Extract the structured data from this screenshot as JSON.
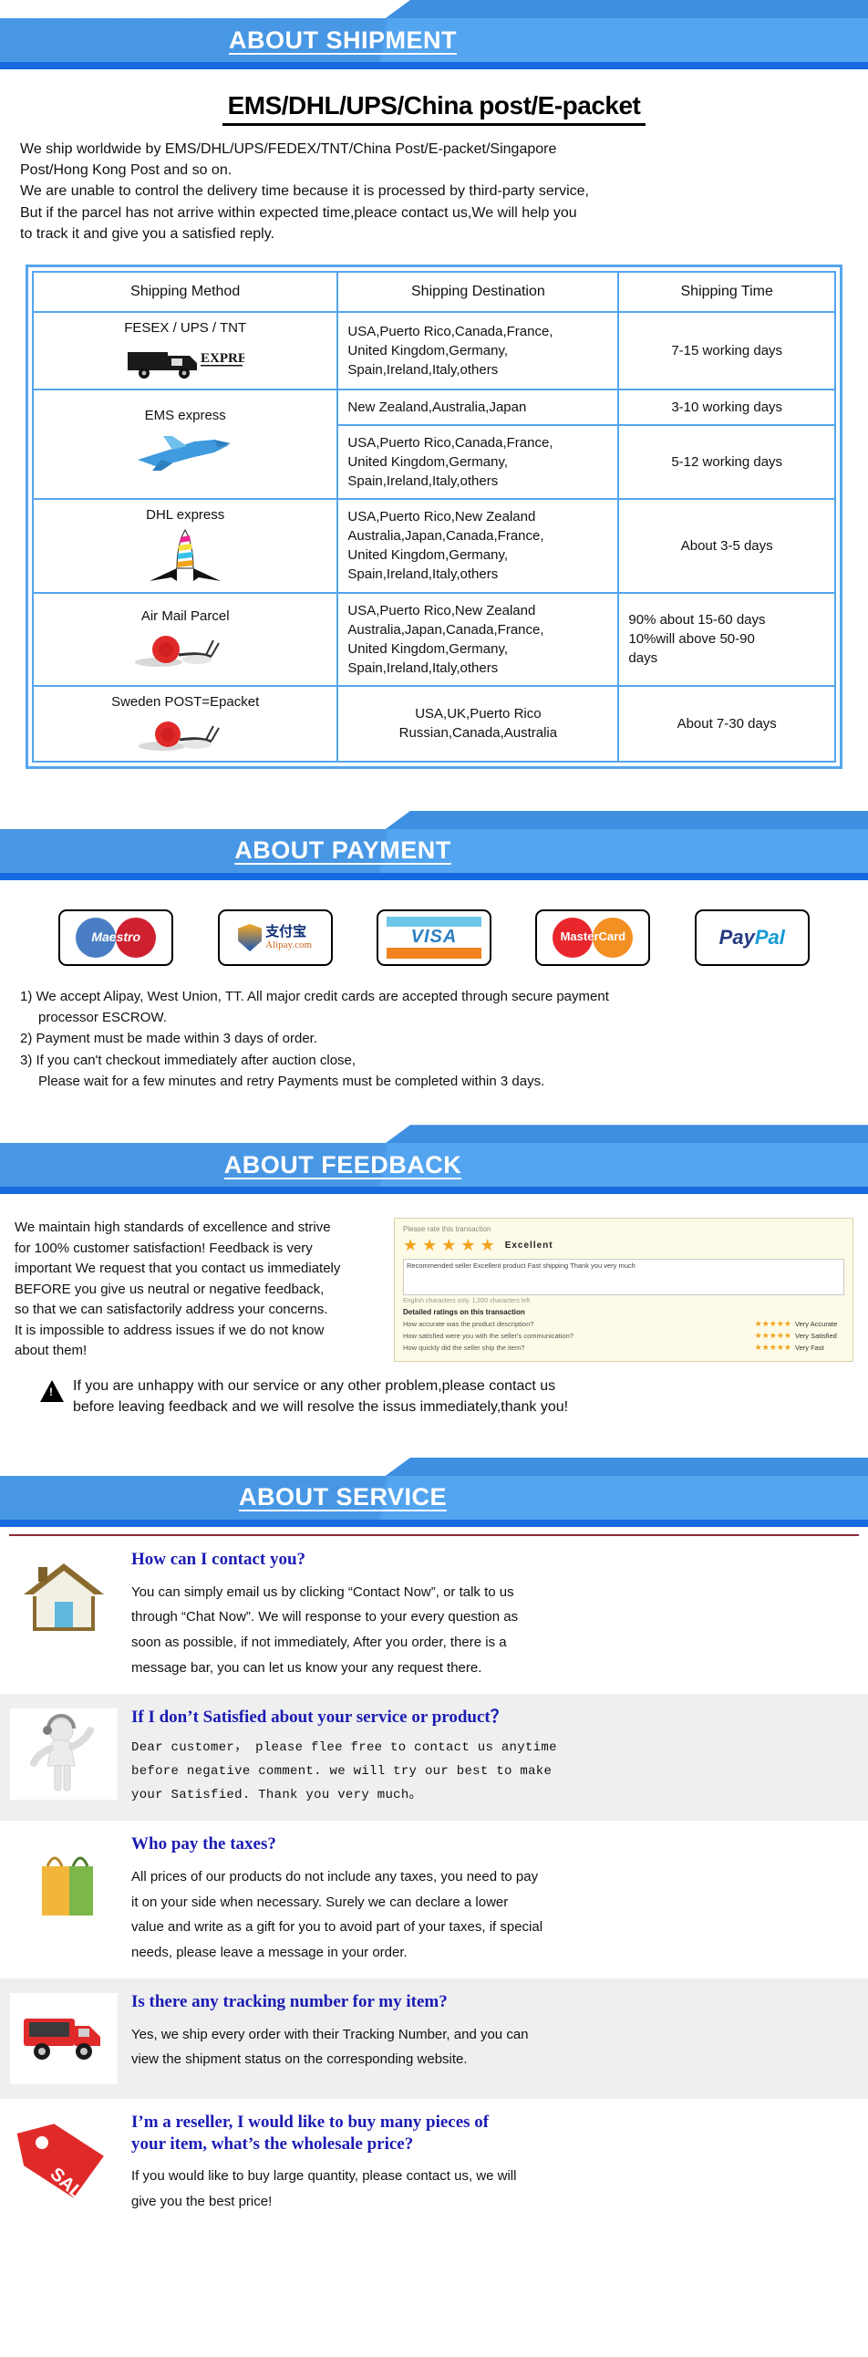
{
  "sections": {
    "shipment": {
      "banner": "ABOUT SHIPMENT",
      "title": "EMS/DHL/UPS/China post/E-packet",
      "intro": [
        "We ship worldwide by EMS/DHL/UPS/FEDEX/TNT/China Post/E-packet/Singapore",
        "Post/Hong Kong Post and so on.",
        "We are unable to control the delivery time because it is processed by third-party service,",
        "But if the parcel has not arrive within expected time,pleace contact us,We will help you",
        "to track it and give you a satisfied reply."
      ],
      "table": {
        "headers": [
          "Shipping Method",
          "Shipping Destination",
          "Shipping Time"
        ],
        "rows": [
          {
            "method": "FESEX / UPS / TNT",
            "icon": "truck-express-icon",
            "destination": "USA,Puerto Rico,Canada,France,\nUnited Kingdom,Germany,\nSpain,Ireland,Italy,others",
            "time": "7-15 working days"
          },
          {
            "method": "EMS express",
            "icon": "airplane-icon",
            "destination": "New Zealand,Australia,Japan",
            "time": "3-10 working days"
          },
          {
            "method": "",
            "icon": "",
            "destination": "USA,Puerto Rico,Canada,France,\nUnited Kingdom,Germany,\nSpain,Ireland,Italy,others",
            "time": "5-12 working days"
          },
          {
            "method": "DHL express",
            "icon": "dhl-rocket-icon",
            "destination": "USA,Puerto Rico,New Zealand\nAustralia,Japan,Canada,France,\nUnited Kingdom,Germany,\nSpain,Ireland,Italy,others",
            "time": "About 3-5 days"
          },
          {
            "method": "Air Mail Parcel",
            "icon": "snail-icon",
            "destination": "USA,Puerto Rico,New Zealand\nAustralia,Japan,Canada,France,\nUnited Kingdom,Germany,\nSpain,Ireland,Italy,others",
            "time": "90% about 15-60 days\n10%will above 50-90\ndays"
          },
          {
            "method": "Sweden POST=Epacket",
            "icon": "snail-icon",
            "destination": "USA,UK,Puerto Rico\nRussian,Canada,Australia",
            "time": "About 7-30 days"
          }
        ]
      }
    },
    "payment": {
      "banner": "ABOUT PAYMENT",
      "logos": [
        {
          "name": "maestro-logo",
          "label": "Maestro"
        },
        {
          "name": "alipay-logo",
          "label": "支付宝",
          "sub": "Alipay.com"
        },
        {
          "name": "visa-logo",
          "label": "VISA"
        },
        {
          "name": "mastercard-logo",
          "label": "MasterCard"
        },
        {
          "name": "paypal-logo",
          "label_a": "Pay",
          "label_b": "Pal"
        }
      ],
      "terms": [
        "1) We accept Alipay, West Union, TT. All major credit cards are accepted through secure payment",
        "processor ESCROW.",
        "2) Payment must be made within 3 days of order.",
        "3) If you can't checkout immediately after auction close,",
        "Please wait for a few minutes and retry Payments must be completed within 3 days."
      ]
    },
    "feedback": {
      "banner": "ABOUT FEEDBACK",
      "text": [
        "We maintain high standards of excellence and strive",
        "for 100% customer satisfaction! Feedback is very",
        "important We request that you contact us immediately",
        "BEFORE you give us neutral or negative feedback,",
        "so that we can satisfactorily address your concerns.",
        "It is impossible to address issues if we do not know",
        "about them!"
      ],
      "widget": {
        "prompt": "Please rate this transaction",
        "rating_label": "Excellent",
        "comment": "Recommended seller Excellent product Fast shipping Thank you very much",
        "char_note": "English characters only, 1,000 characters left",
        "detail_header": "Detailed ratings on this transaction",
        "detail_rows": [
          {
            "question": "How accurate was the product description?",
            "value": "Very Accurate"
          },
          {
            "question": "How satisfied were you with the seller's communication?",
            "value": "Very Satisfied"
          },
          {
            "question": "How quickly did the seller ship the item?",
            "value": "Very Fast"
          }
        ]
      },
      "warning": [
        "If you are unhappy with our service or any other problem,please contact us",
        "before leaving feedback and we will resolve the issus immediately,thank you!"
      ]
    },
    "service": {
      "banner": "ABOUT SERVICE",
      "items": [
        {
          "icon": "house-icon",
          "question": "How can I contact you?",
          "answer_lines": [
            "You can simply email us by clicking “Contact Now”, or talk to us",
            "through “Chat Now”. We will response to your every question as",
            "soon as possible, if not immediately, After you order, there is a",
            "message bar, you can let us know your any request there."
          ],
          "style": "normal"
        },
        {
          "icon": "support-person-icon",
          "question": "If I don’t Satisfied about your service or product？",
          "answer_lines": [
            "Dear customer， please flee free to contact us anytime",
            "before negative comment. we will try our best to make",
            "your Satisfied.  Thank you very much。"
          ],
          "style": "mono"
        },
        {
          "icon": "shopping-bag-icon",
          "question": "Who pay the taxes?",
          "answer_lines": [
            " All prices of our products do not include any taxes, you need to pay",
            "it on your side when necessary. Surely we can declare a lower",
            "value and write as a gift for you to avoid part of your taxes, if special",
            "needs, please leave a message in your order."
          ],
          "style": "normal"
        },
        {
          "icon": "delivery-truck-icon",
          "question": "Is there any tracking number for my item?",
          "answer_lines": [
            " Yes, we ship every order with their Tracking Number, and you can",
            "view the shipment status on the corresponding website."
          ],
          "style": "normal"
        },
        {
          "icon": "sale-tag-icon",
          "question": "I’m a reseller, I would like to buy many pieces of\nyour item, what’s the wholesale price?",
          "answer_lines": [
            " If you would like to buy large quantity, please contact us, we will",
            "give you the best price!"
          ],
          "style": "normal"
        }
      ]
    }
  },
  "colors": {
    "banner_light": "#54a5f0",
    "banner_dark": "#1769e0",
    "table_border": "#54a5f0",
    "question_blue": "#1b1bb5",
    "alt_row": "#efefef",
    "star_gold": "#f2a21c"
  }
}
